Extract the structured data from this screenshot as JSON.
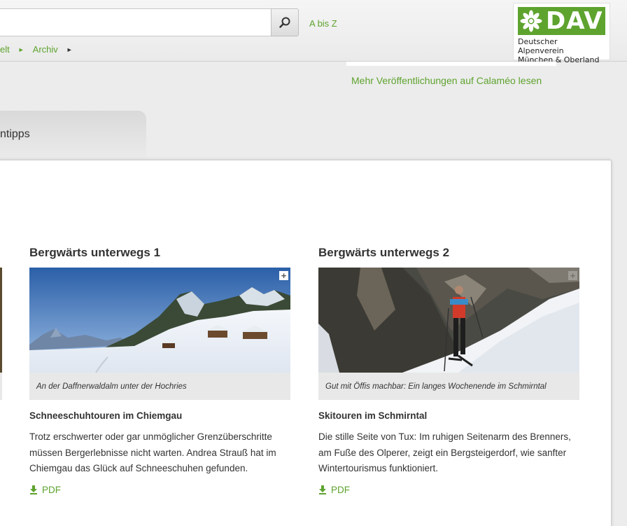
{
  "header": {
    "search": {
      "value": "",
      "placeholder": ""
    },
    "a_bis_z": "A bis Z",
    "breadcrumb": [
      {
        "label": "elt"
      },
      {
        "label": "Archiv"
      }
    ],
    "logo": {
      "wordmark": "DAV",
      "line1": "Deutscher Alpenverein",
      "line2": "München & Oberland"
    }
  },
  "calameo_link": "Mehr Veröffentlichungen auf Calaméo lesen",
  "tab": {
    "label": "ntipps"
  },
  "cards": [
    {
      "heading": "Bergwärts unterwegs 1",
      "caption": "An der Daffnerwaldalm unter der Hochries",
      "title": "Schneeschuhtouren im Chiemgau",
      "text": "Trotz erschwerter oder gar unmöglicher Grenzüberschritte müssen Bergerlebnisse nicht warten. Andrea Strauß hat im Chiemgau das Glück auf Schneeschuhen gefunden.",
      "pdf": "PDF"
    },
    {
      "heading": "Bergwärts unterwegs 2",
      "caption": "Gut mit Öffis machbar: Ein langes Wochenende im Schmirntal",
      "title": "Skitouren im Schmirntal",
      "text": "Die stille Seite von Tux: Im ruhigen Seitenarm des Brenners, am Fuße des Olperer, zeigt ein Bergsteigerdorf, wie sanfter Wintertourismus funktioniert.",
      "pdf": "PDF"
    }
  ],
  "colors": {
    "accent": "#5ea32e",
    "panel": "#ffffff",
    "background": "#ececec"
  },
  "icons": [
    "search-icon",
    "edelweiss-logo-icon",
    "expand-plus-icon",
    "download-icon"
  ]
}
